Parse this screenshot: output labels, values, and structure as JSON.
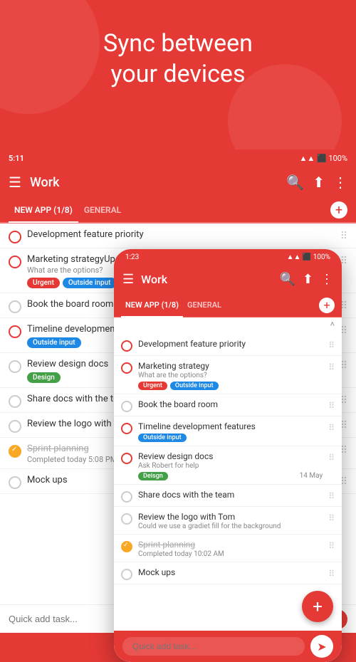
{
  "hero": {
    "title_line1": "Sync between",
    "title_line2": "your devices"
  },
  "app": {
    "title": "Work",
    "status_time_tablet": "5:11",
    "status_time_phone": "1:23",
    "tabs": [
      {
        "id": "new-app",
        "label": "NEW APP (1/8)",
        "active": true
      },
      {
        "id": "general",
        "label": "GENERAL",
        "active": false
      }
    ],
    "add_button_label": "+",
    "tasks": [
      {
        "id": "task-1",
        "title": "Development feature priority",
        "subtitle": "",
        "done": false,
        "red_circle": true,
        "tags": [],
        "date": ""
      },
      {
        "id": "task-2",
        "title": "Marketing strategy",
        "subtitle": "What are the options?",
        "done": false,
        "red_circle": true,
        "tags": [
          "Urgent",
          "Outside input"
        ],
        "date": ""
      },
      {
        "id": "task-3",
        "title": "Book the board room",
        "subtitle": "",
        "done": false,
        "red_circle": false,
        "tags": [],
        "date": ""
      },
      {
        "id": "task-4",
        "title": "Timeline development features",
        "subtitle": "",
        "done": false,
        "red_circle": true,
        "tags": [
          "Outside input"
        ],
        "date": ""
      },
      {
        "id": "task-5",
        "title": "Review design docs",
        "subtitle": "Ask Robert for help",
        "done": false,
        "red_circle": true,
        "tags": [
          "Deisgn"
        ],
        "date": "14 May"
      },
      {
        "id": "task-6",
        "title": "Share docs with the team",
        "subtitle": "",
        "done": false,
        "red_circle": false,
        "tags": [],
        "date": ""
      },
      {
        "id": "task-7",
        "title": "Review the logo with Tom",
        "subtitle": "Could we use a gradiet fill for the background",
        "done": false,
        "red_circle": false,
        "tags": [],
        "date": ""
      },
      {
        "id": "task-8",
        "title": "Sprint planning",
        "subtitle": "Completed today 10:02 AM",
        "done": true,
        "red_circle": false,
        "tags": [],
        "date": ""
      },
      {
        "id": "task-9",
        "title": "Mock ups",
        "subtitle": "",
        "done": false,
        "red_circle": false,
        "tags": [],
        "date": ""
      }
    ],
    "tablet_tasks": [
      {
        "id": "t1",
        "title": "Development feature priority",
        "subtitle": "",
        "done": false,
        "red_circle": true,
        "tags": [],
        "date": ""
      },
      {
        "id": "t2",
        "title": "Marketing strategyUpdate CV",
        "subtitle": "What are the options?",
        "done": false,
        "red_circle": true,
        "tags": [
          "Urgent",
          "Outside input"
        ],
        "date": ""
      },
      {
        "id": "t3",
        "title": "Book the board room",
        "subtitle": "",
        "done": false,
        "red_circle": false,
        "tags": [],
        "date": ""
      },
      {
        "id": "t4",
        "title": "Timeline development features",
        "subtitle": "",
        "done": false,
        "red_circle": true,
        "tags": [
          "Outside input"
        ],
        "date": ""
      },
      {
        "id": "t5",
        "title": "Review design docs",
        "subtitle": "",
        "done": false,
        "red_circle": false,
        "tags": [
          "Design"
        ],
        "date": ""
      },
      {
        "id": "t6",
        "title": "Share docs with the team",
        "subtitle": "",
        "done": false,
        "red_circle": false,
        "tags": [],
        "date": ""
      },
      {
        "id": "t7",
        "title": "Review the logo with Tom",
        "subtitle": "",
        "done": false,
        "red_circle": false,
        "tags": [],
        "date": ""
      },
      {
        "id": "t8",
        "title": "Sprint planning",
        "subtitle": "Completed today 5:08 PM",
        "done": true,
        "red_circle": false,
        "tags": [],
        "date": ""
      },
      {
        "id": "t9",
        "title": "Mock ups",
        "subtitle": "",
        "done": false,
        "red_circle": false,
        "tags": [],
        "date": ""
      }
    ],
    "quick_add_placeholder": "Quick add task...",
    "quick_add_placeholder_phone": "Quick add task..."
  },
  "colors": {
    "primary": "#e53935",
    "urgent_tag": "#e53935",
    "outside_tag": "#1e88e5",
    "design_tag": "#43a047",
    "done_icon": "#f9a825"
  }
}
